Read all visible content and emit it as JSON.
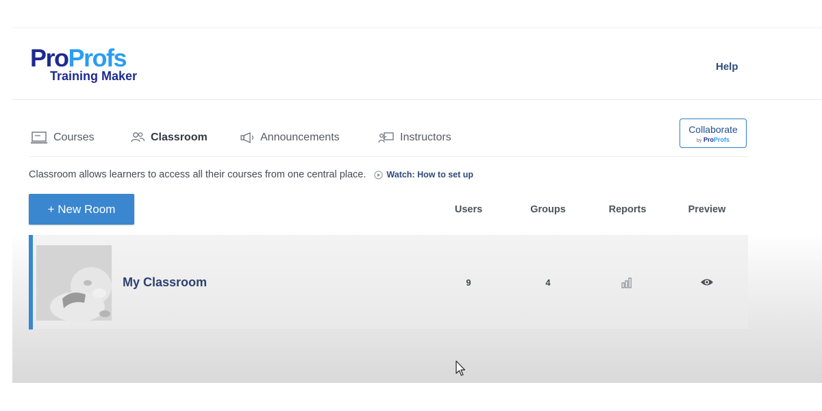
{
  "header": {
    "logo_pro_1": "Pro",
    "logo_pro_2": "Profs",
    "logo_sub": "Training Maker",
    "help_label": "Help"
  },
  "tabs": [
    {
      "label": "Courses",
      "icon": "laptop-icon",
      "active": false
    },
    {
      "label": "Classroom",
      "icon": "users-icon",
      "active": true
    },
    {
      "label": "Announcements",
      "icon": "megaphone-icon",
      "active": false
    },
    {
      "label": "Instructors",
      "icon": "instructor-icon",
      "active": false
    }
  ],
  "collaborate": {
    "label": "Collaborate",
    "by": "by",
    "brand_1": "Pro",
    "brand_2": "Profs"
  },
  "info": {
    "text": "Classroom allows learners to access all their courses from one central place.",
    "watch_label": "Watch: How to set up",
    "watch_icon": "play-circle-icon"
  },
  "toolbar": {
    "new_room_label": "+ New Room"
  },
  "table": {
    "columns": [
      "Users",
      "Groups",
      "Reports",
      "Preview"
    ],
    "rows": [
      {
        "name": "My Classroom",
        "users": "9",
        "groups": "4",
        "reports_icon": "bar-chart-icon",
        "preview_icon": "eye-icon"
      }
    ]
  },
  "colors": {
    "brand_dark": "#1d2b8f",
    "brand_light": "#2a9df4",
    "accent_blue": "#3a86cf",
    "link_navy": "#2d4a7a"
  }
}
